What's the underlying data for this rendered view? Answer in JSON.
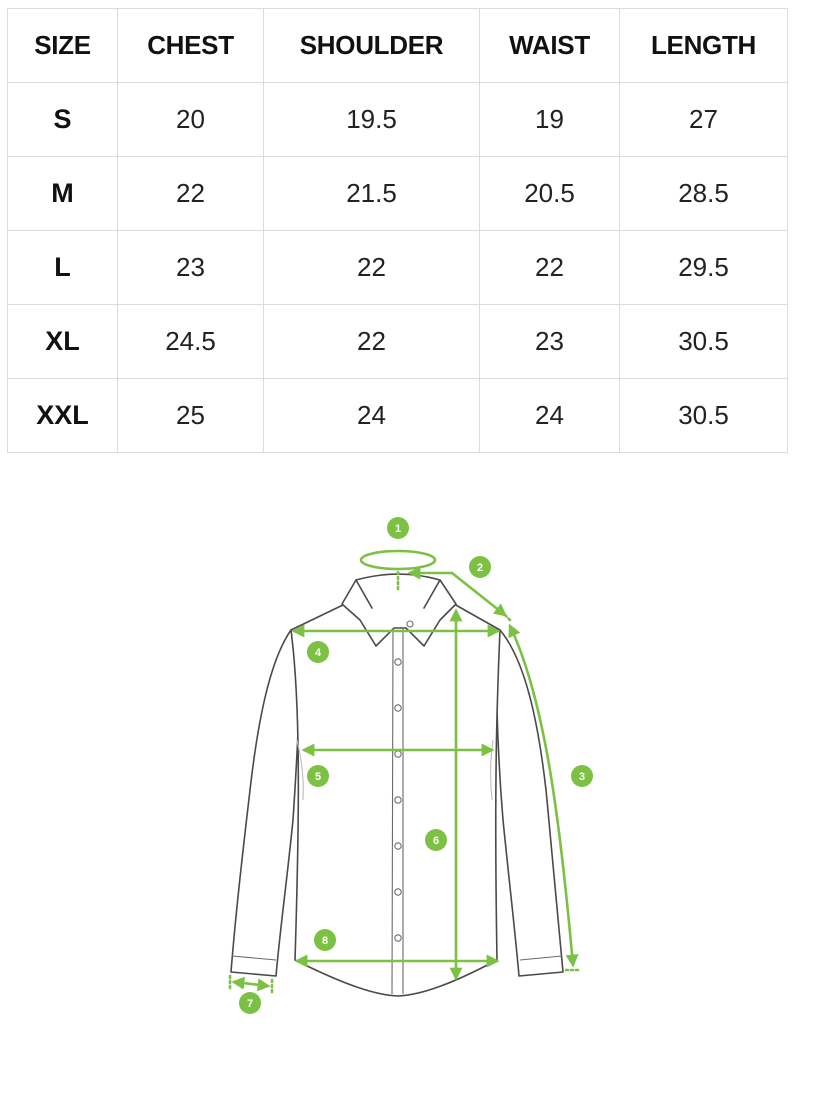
{
  "size_chart": {
    "headers": [
      "SIZE",
      "CHEST",
      "SHOULDER",
      "WAIST",
      "LENGTH"
    ],
    "rows": [
      [
        "S",
        "20",
        "19.5",
        "19",
        "27"
      ],
      [
        "M",
        "22",
        "21.5",
        "20.5",
        "28.5"
      ],
      [
        "L",
        "23",
        "22",
        "22",
        "29.5"
      ],
      [
        "XL",
        "24.5",
        "22",
        "23",
        "30.5"
      ],
      [
        "XXL",
        "25",
        "24",
        "24",
        "30.5"
      ]
    ]
  },
  "diagram": {
    "markers": [
      "1",
      "2",
      "3",
      "4",
      "5",
      "6",
      "7",
      "8"
    ],
    "accent_color": "#7cc143",
    "outline_color": "#4a4a4a"
  }
}
